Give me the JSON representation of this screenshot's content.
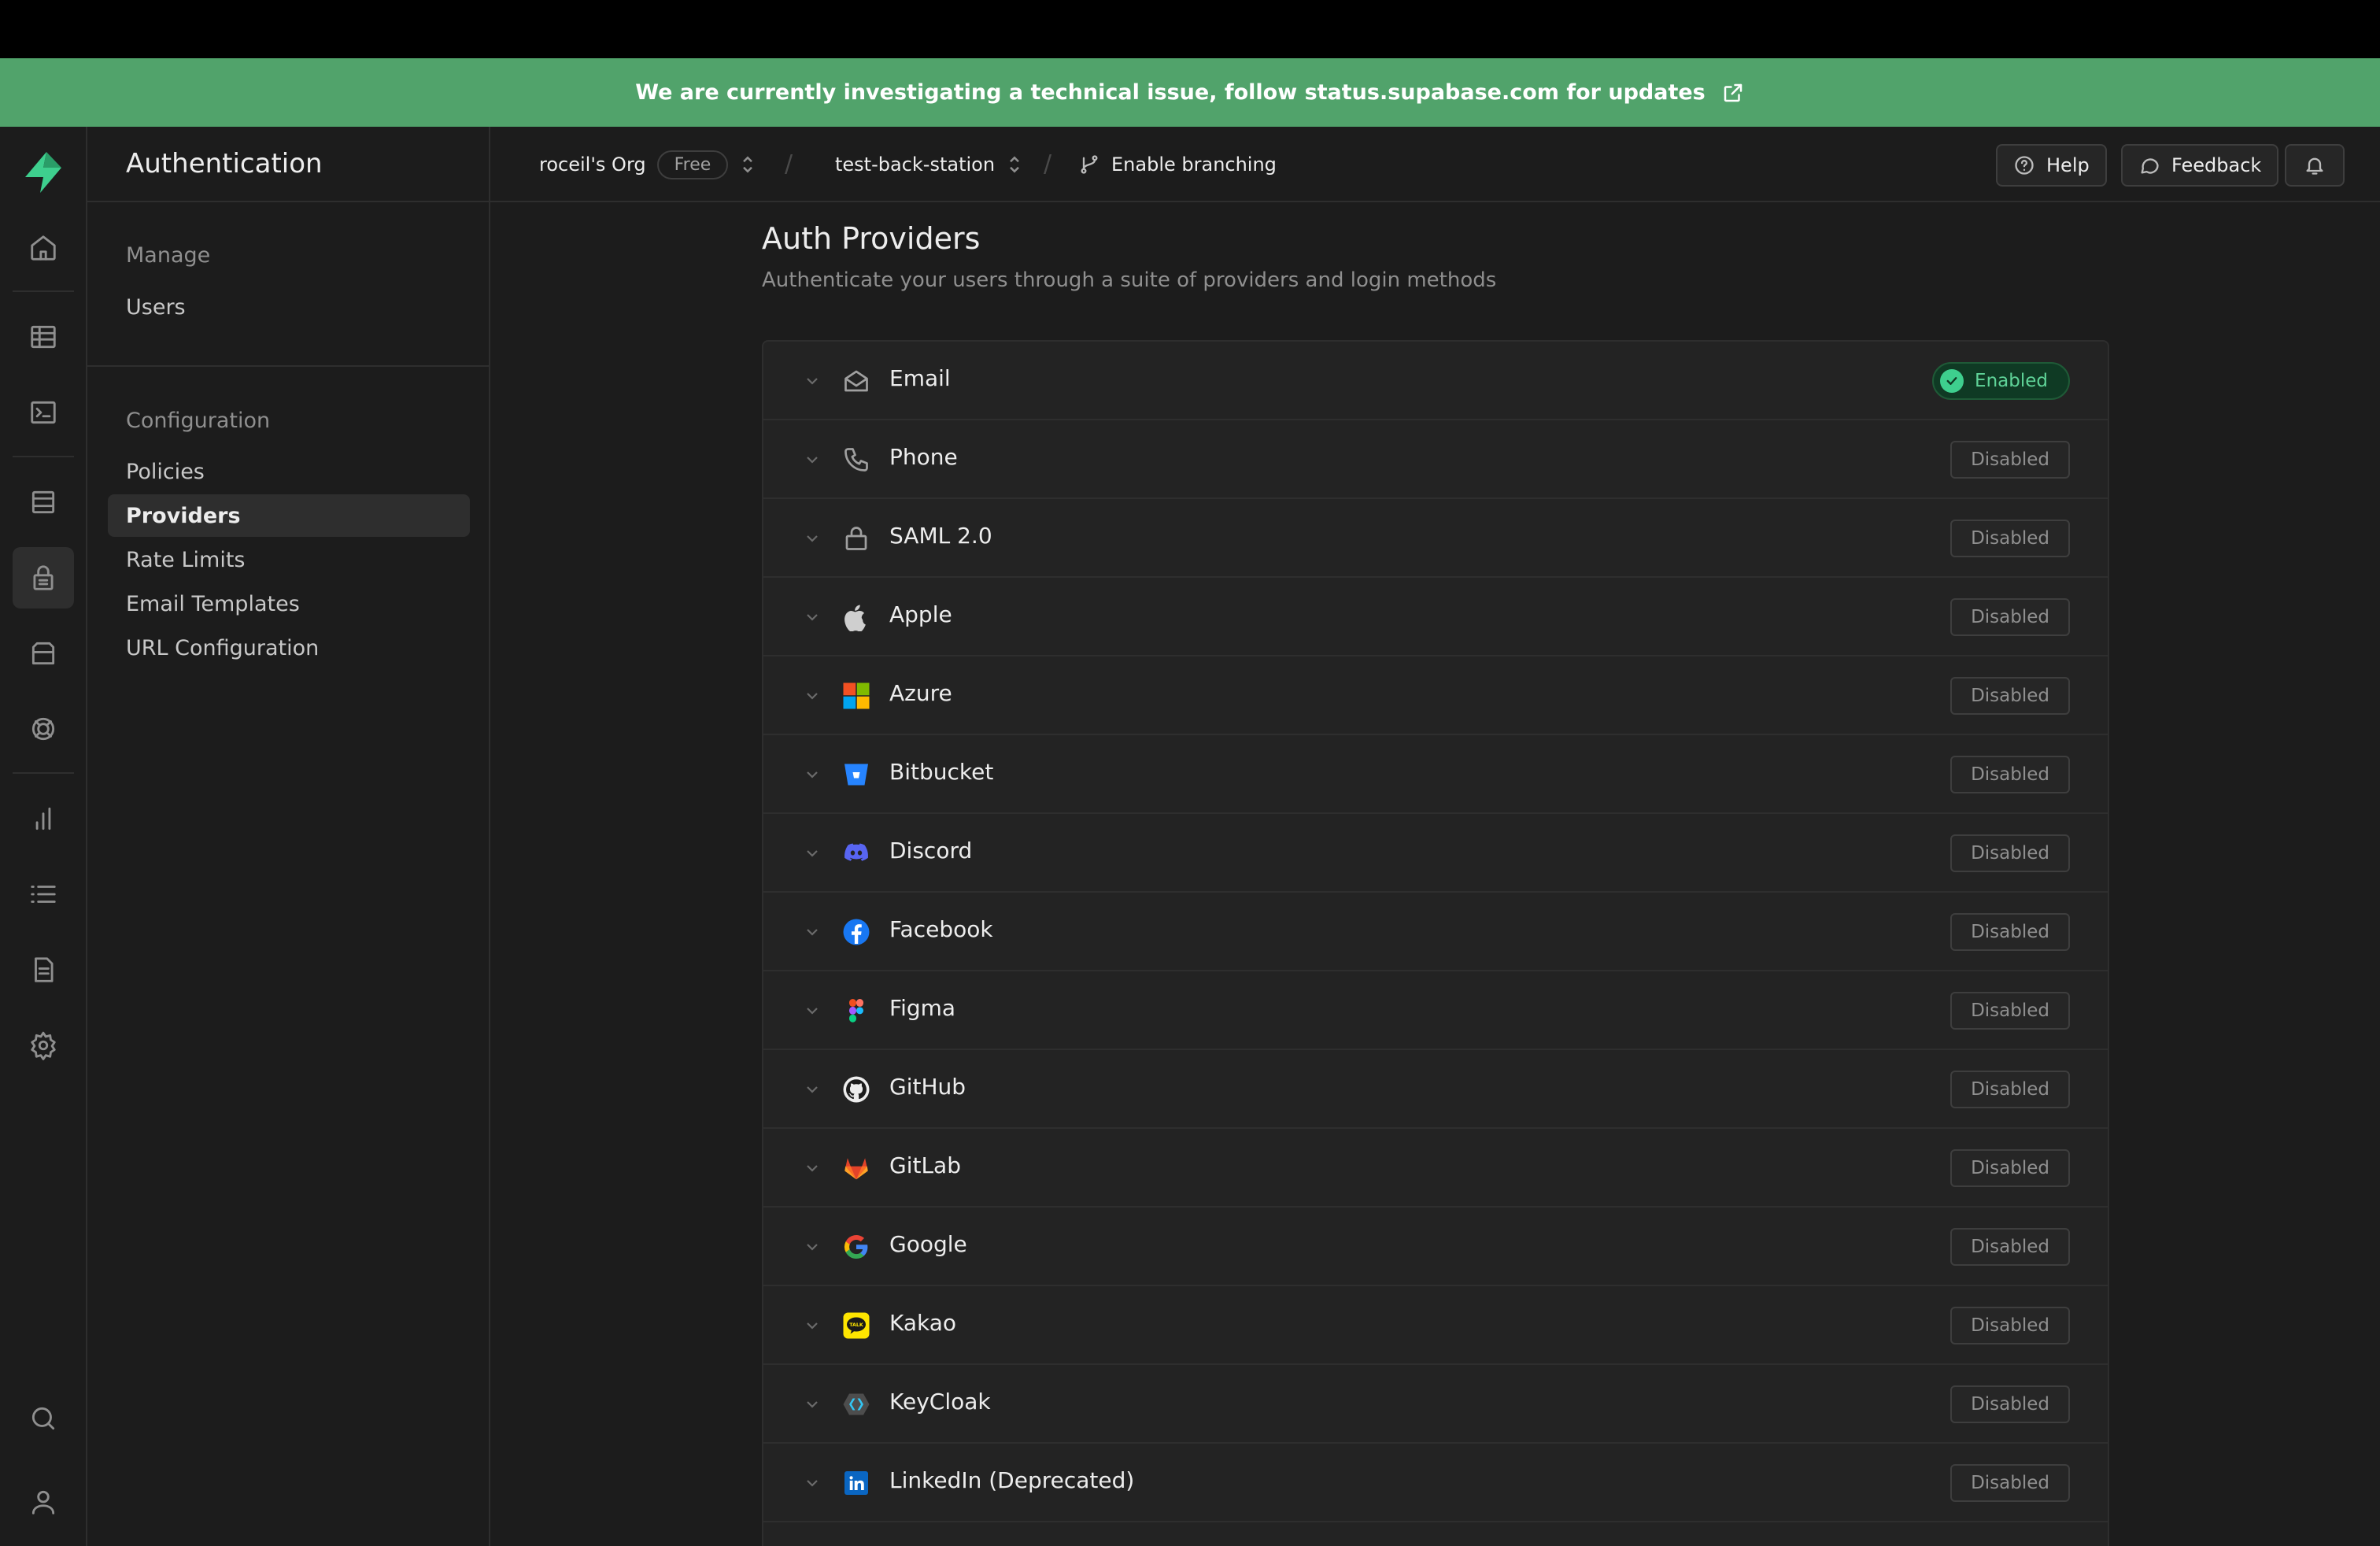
{
  "banner": {
    "text": "We are currently investigating a technical issue, follow status.supabase.com for updates",
    "icon": "external-link-icon"
  },
  "sidebar_rail": {
    "items": [
      {
        "name": "home-icon"
      },
      {
        "name": "table-editor-icon"
      },
      {
        "name": "sql-editor-icon"
      },
      {
        "name": "database-icon"
      },
      {
        "name": "authentication-icon",
        "active": true
      },
      {
        "name": "storage-icon"
      },
      {
        "name": "realtime-icon"
      },
      {
        "name": "reports-icon"
      },
      {
        "name": "logs-icon"
      },
      {
        "name": "api-docs-icon"
      },
      {
        "name": "settings-icon"
      },
      {
        "name": "search-icon"
      },
      {
        "name": "user-icon"
      }
    ]
  },
  "subnav": {
    "title": "Authentication",
    "sections": [
      {
        "title": "Manage",
        "links": [
          "Users"
        ]
      },
      {
        "title": "Configuration",
        "links": [
          "Policies",
          "Providers",
          "Rate Limits",
          "Email Templates",
          "URL Configuration"
        ]
      }
    ],
    "active": "Providers"
  },
  "topbar": {
    "org": "roceil's Org",
    "plan": "Free",
    "project": "test-back-station",
    "branching": "Enable branching",
    "help": "Help",
    "feedback": "Feedback"
  },
  "page": {
    "title": "Auth Providers",
    "subtitle": "Authenticate your users through a suite of providers and login methods"
  },
  "providers": [
    {
      "name": "Email",
      "status": "Enabled",
      "icon": "email-icon"
    },
    {
      "name": "Phone",
      "status": "Disabled",
      "icon": "phone-icon"
    },
    {
      "name": "SAML 2.0",
      "status": "Disabled",
      "icon": "lock-icon"
    },
    {
      "name": "Apple",
      "status": "Disabled",
      "icon": "apple-icon"
    },
    {
      "name": "Azure",
      "status": "Disabled",
      "icon": "azure-icon"
    },
    {
      "name": "Bitbucket",
      "status": "Disabled",
      "icon": "bitbucket-icon"
    },
    {
      "name": "Discord",
      "status": "Disabled",
      "icon": "discord-icon"
    },
    {
      "name": "Facebook",
      "status": "Disabled",
      "icon": "facebook-icon"
    },
    {
      "name": "Figma",
      "status": "Disabled",
      "icon": "figma-icon"
    },
    {
      "name": "GitHub",
      "status": "Disabled",
      "icon": "github-icon"
    },
    {
      "name": "GitLab",
      "status": "Disabled",
      "icon": "gitlab-icon"
    },
    {
      "name": "Google",
      "status": "Disabled",
      "icon": "google-icon"
    },
    {
      "name": "Kakao",
      "status": "Disabled",
      "icon": "kakao-icon"
    },
    {
      "name": "KeyCloak",
      "status": "Disabled",
      "icon": "keycloak-icon"
    },
    {
      "name": "LinkedIn (Deprecated)",
      "status": "Disabled",
      "icon": "linkedin-icon"
    }
  ],
  "colors": {
    "accent": "#3ecf8e",
    "banner": "#51a36b",
    "background": "#1c1c1c"
  }
}
